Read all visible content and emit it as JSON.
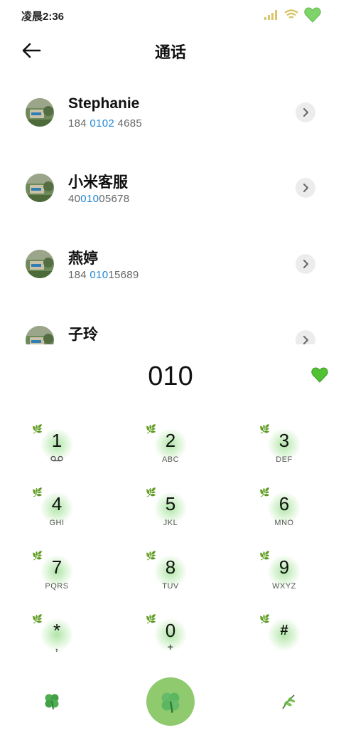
{
  "status": {
    "time": "凌晨2:36"
  },
  "header": {
    "title": "通话"
  },
  "contacts": [
    {
      "name": "Stephanie",
      "num_pre": "184 ",
      "num_hl": "0102",
      "num_post": " 4685"
    },
    {
      "name": "小米客服",
      "num_pre": "40",
      "num_hl": "010",
      "num_post": "05678"
    },
    {
      "name": "燕婷",
      "num_pre": "184 ",
      "num_hl": "010",
      "num_post": "15689"
    },
    {
      "name": "子玲",
      "num_pre": "",
      "num_hl": "",
      "num_post": ""
    }
  ],
  "dialer": {
    "input": "010",
    "keys": [
      {
        "digit": "1",
        "letters": ""
      },
      {
        "digit": "2",
        "letters": "ABC"
      },
      {
        "digit": "3",
        "letters": "DEF"
      },
      {
        "digit": "4",
        "letters": "GHI"
      },
      {
        "digit": "5",
        "letters": "JKL"
      },
      {
        "digit": "6",
        "letters": "MNO"
      },
      {
        "digit": "7",
        "letters": "PQRS"
      },
      {
        "digit": "8",
        "letters": "TUV"
      },
      {
        "digit": "9",
        "letters": "WXYZ"
      },
      {
        "digit": "*",
        "letters": ","
      },
      {
        "digit": "0",
        "letters": "+"
      },
      {
        "digit": "#",
        "letters": ""
      }
    ]
  },
  "icons": {
    "back": "arrow-left-icon",
    "chevron": "chevron-right-icon",
    "voicemail": "voicemail-icon",
    "heart": "green-heart-icon",
    "clover": "four-leaf-clover-icon",
    "leaf": "leaf-sprig-icon"
  },
  "colors": {
    "accent_green": "#8fca6e",
    "highlight_blue": "#1e88d8",
    "heart_green": "#52c234"
  }
}
